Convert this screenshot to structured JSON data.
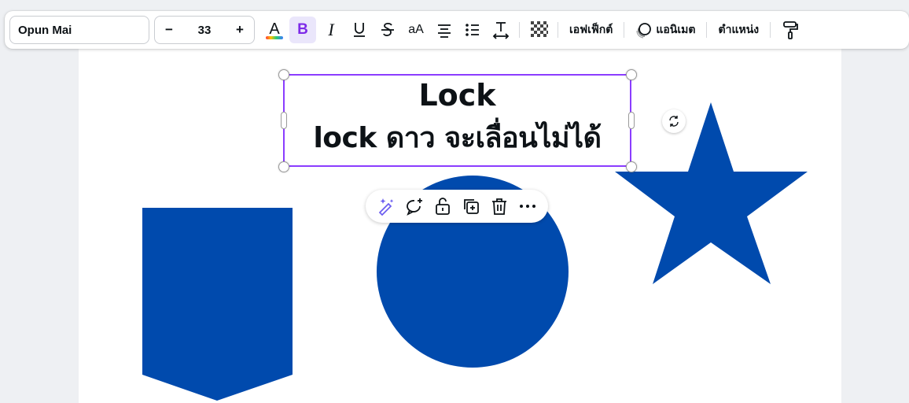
{
  "toolbar": {
    "font_name": "Opun Mai",
    "font_size": "33",
    "decrease": "−",
    "increase": "+",
    "bold_label": "B",
    "italic_label": "I",
    "case_label": "aA",
    "effects_label": "เอฟเฟ็กต์",
    "animate_label": "แอนิเมต",
    "position_label": "ตำแหน่ง"
  },
  "textbox": {
    "line1": "Lock",
    "line2": "lock ดาว จะเลื่อนไม่ได้"
  },
  "colors": {
    "accent": "#8b3dff",
    "shape_blue": "#004aad",
    "bold_active": "#7d2ae8"
  },
  "icons": [
    "text-color-icon",
    "underline-icon",
    "strikethrough-icon",
    "align-center-icon",
    "list-icon",
    "spacing-icon",
    "transparency-icon",
    "animate-icon",
    "paint-roller-icon",
    "rotate-icon",
    "magic-edit-icon",
    "comment-icon",
    "unlock-icon",
    "duplicate-icon",
    "trash-icon",
    "more-icon"
  ]
}
